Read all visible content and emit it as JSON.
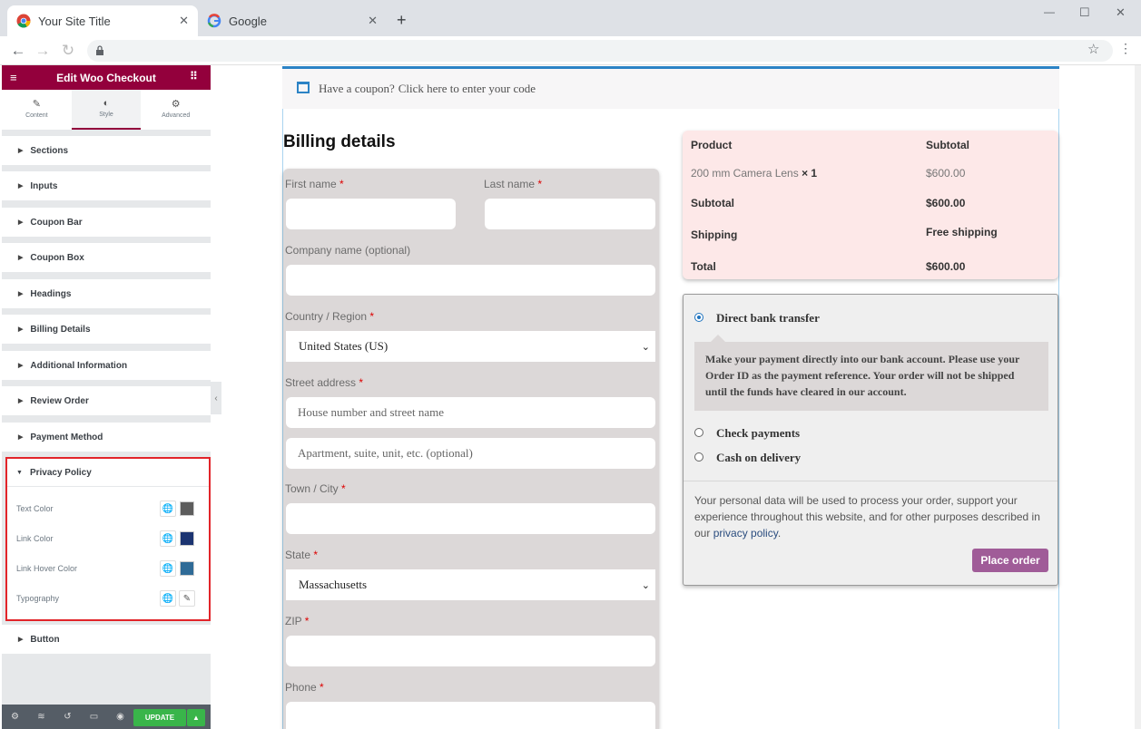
{
  "browser": {
    "tabs": [
      {
        "title": "Your Site Title"
      },
      {
        "title": "Google"
      }
    ],
    "new_tab": "+",
    "window_controls": {
      "minimize": "—",
      "maximize": "☐",
      "close": "✕"
    }
  },
  "editor": {
    "title": "Edit Woo Checkout",
    "tabs": [
      {
        "label": "Content",
        "icon": "pencil-icon"
      },
      {
        "label": "Style",
        "icon": "contrast-icon"
      },
      {
        "label": "Advanced",
        "icon": "gear-icon"
      }
    ],
    "sections": [
      "Sections",
      "Inputs",
      "Coupon Bar",
      "Coupon Box",
      "Headings",
      "Billing Details",
      "Additional Information",
      "Review Order",
      "Payment Method"
    ],
    "privacy": {
      "title": "Privacy Policy",
      "rows": [
        {
          "label": "Text Color",
          "color": "#5d5d5d"
        },
        {
          "label": "Link Color",
          "color": "#1c3471"
        },
        {
          "label": "Link Hover Color",
          "color": "#2f6b97"
        },
        {
          "label": "Typography"
        }
      ]
    },
    "button_section": "Button",
    "update": "UPDATE",
    "accent": "#93003c"
  },
  "coupon": {
    "text": "Have a coupon?",
    "link": "Click here to enter your code"
  },
  "billing": {
    "title": "Billing details",
    "first_name": "First name",
    "last_name": "Last name",
    "company": "Company name (optional)",
    "country_label": "Country / Region",
    "country_value": "United States (US)",
    "street_label": "Street address",
    "street_placeholder": "House number and street name",
    "street2_placeholder": "Apartment, suite, unit, etc. (optional)",
    "city": "Town / City",
    "state_label": "State",
    "state_value": "Massachusetts",
    "zip": "ZIP",
    "phone": "Phone",
    "required_mark": "*"
  },
  "order": {
    "col_product": "Product",
    "col_subtotal": "Subtotal",
    "item_name": "200 mm Camera Lens",
    "item_qty": "× 1",
    "item_price": "$600.00",
    "subtotal_label": "Subtotal",
    "subtotal_value": "$600.00",
    "shipping_label": "Shipping",
    "shipping_value": "Free shipping",
    "total_label": "Total",
    "total_value": "$600.00"
  },
  "payment": {
    "methods": [
      "Direct bank transfer",
      "Check payments",
      "Cash on delivery"
    ],
    "description": "Make your payment directly into our bank account. Please use your Order ID as the payment reference. Your order will not be shipped until the funds have cleared in our account.",
    "privacy_text": "Your personal data will be used to process your order, support your experience throughout this website, and for other purposes described in our",
    "privacy_link": "privacy policy",
    "place_order": "Place order"
  }
}
